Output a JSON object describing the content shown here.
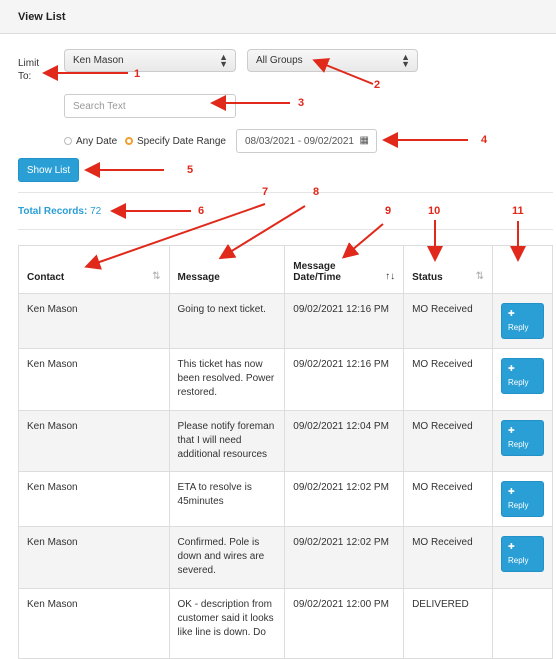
{
  "header": {
    "title": "View List"
  },
  "filters": {
    "limit_label": "Limit To:",
    "user_select": "Ken Mason",
    "group_select": "All Groups",
    "search_placeholder": "Search Text",
    "radio_any_date": "Any Date",
    "radio_date_range": "Specify Date Range",
    "date_range_value": "08/03/2021 - 09/02/2021",
    "show_button": "Show List"
  },
  "summary": {
    "total_label": "Total Records:",
    "total_value": "72"
  },
  "table": {
    "columns": [
      "Contact",
      "Message",
      "Message Date/Time",
      "Status",
      ""
    ],
    "rows": [
      {
        "contact": "Ken Mason",
        "message": "Going to next ticket.",
        "datetime": "09/02/2021 12:16 PM",
        "status": "MO Received",
        "action": "Reply"
      },
      {
        "contact": "Ken Mason",
        "message": "This ticket has now been resolved. Power restored.",
        "datetime": "09/02/2021 12:16 PM",
        "status": "MO Received",
        "action": "Reply"
      },
      {
        "contact": "Ken Mason",
        "message": "Please notify foreman that I will need additional resources",
        "datetime": "09/02/2021 12:04 PM",
        "status": "MO Received",
        "action": "Reply"
      },
      {
        "contact": "Ken Mason",
        "message": "ETA to resolve is 45minutes",
        "datetime": "09/02/2021 12:02 PM",
        "status": "MO Received",
        "action": "Reply"
      },
      {
        "contact": "Ken Mason",
        "message": "Confirmed. Pole is down and wires are severed.",
        "datetime": "09/02/2021 12:02 PM",
        "status": "MO Received",
        "action": "Reply"
      },
      {
        "contact": "Ken Mason",
        "message": "OK - description from customer said it looks like line is down. Do",
        "datetime": "09/02/2021 12:00 PM",
        "status": "DELIVERED",
        "action": ""
      }
    ]
  },
  "annotations": [
    "1",
    "2",
    "3",
    "4",
    "5",
    "6",
    "7",
    "8",
    "9",
    "10",
    "11"
  ],
  "colors": {
    "accent": "#2a9fd6",
    "annotation": "#e0281b",
    "radio_checked": "#f0a030"
  }
}
